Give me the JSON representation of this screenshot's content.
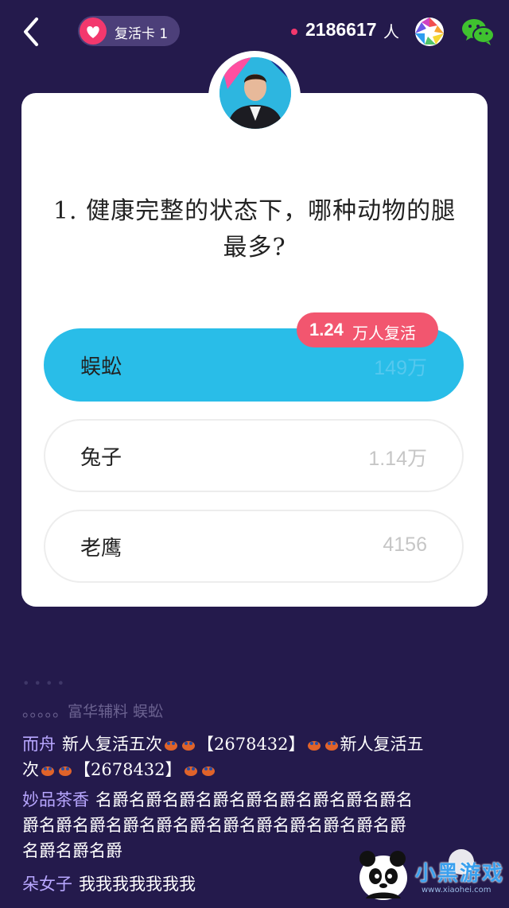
{
  "topbar": {
    "revive_card": "复活卡 1",
    "online_count": "2186617",
    "online_unit": "人"
  },
  "question": {
    "text": "1. 健康完整的状态下，哪种动物的腿最多?"
  },
  "options": [
    {
      "label": "蜈蚣",
      "count": "149万",
      "selected": true
    },
    {
      "label": "兔子",
      "count": "1.14万",
      "selected": false
    },
    {
      "label": "老鹰",
      "count": "4156",
      "selected": false
    }
  ],
  "badge": {
    "number": "1.24",
    "text": "万人复活"
  },
  "chat": {
    "faded_line": "。。。。。富华辅料 蜈蚣",
    "messages": [
      {
        "user": "而舟",
        "text_parts": [
          "新人复活五次",
          "【2678432】",
          "新人复活五次",
          "【2678432】"
        ]
      },
      {
        "user": "妙品茶香",
        "text": "名爵名爵名爵名爵名爵名爵名爵名爵名爵名爵名爵名爵名爵名爵名爵名爵名爵名爵名爵名爵名爵名爵名爵名爵"
      },
      {
        "user": "朵女子",
        "text": "我我我我我我我"
      }
    ]
  },
  "watermark": {
    "name": "小黑游戏",
    "url": "www.xiaohei.com"
  },
  "colors": {
    "background": "#241a4c",
    "card": "#ffffff",
    "selected_option": "#29bde8",
    "badge": "#f2566f",
    "accent_pink": "#f3386d"
  }
}
